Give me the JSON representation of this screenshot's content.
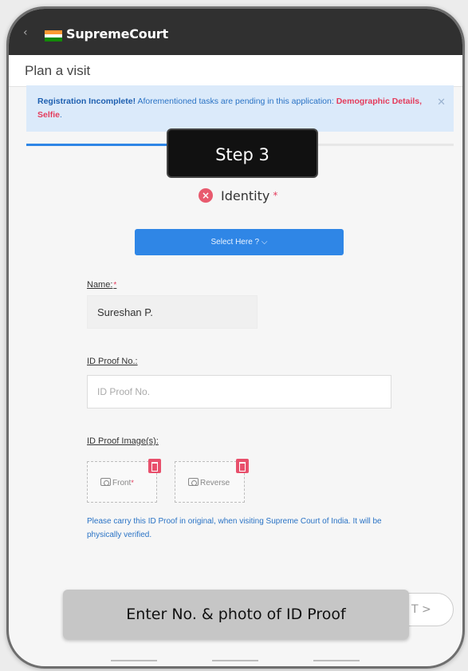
{
  "app": {
    "title": "SupremeCourt",
    "back_icon": "back-arrow-icon"
  },
  "page": {
    "title": "Plan a visit"
  },
  "alert": {
    "strong": "Registration Incomplete!",
    "text": "Aforementioned tasks are pending in this application:",
    "pending": "Demographic Details, Selfie",
    "end": ".",
    "close": "✕"
  },
  "overlay": {
    "step": "Step 3",
    "caption": "Enter No. & photo of ID Proof"
  },
  "identity": {
    "label": "Identity",
    "required": "*",
    "status_icon": "error-x-icon"
  },
  "select": {
    "label": "Select Here ?  ⌵"
  },
  "form": {
    "name_label": "Name:",
    "name_required": "*",
    "name_value": "Sureshan P.",
    "id_label": "ID Proof No.:",
    "id_placeholder": "ID Proof No.",
    "image_label": "ID Proof Image(s):",
    "front_label": "Front",
    "front_required": "*",
    "reverse_label": "Reverse",
    "note": "Please carry this ID Proof in original, when visiting Supreme Court of India. It will be physically verified."
  },
  "nav": {
    "next_label": "T  >"
  },
  "colors": {
    "accent": "#2f86e6",
    "danger": "#e43c5c",
    "alert_bg": "#dbeafa",
    "appbar": "#303030"
  }
}
